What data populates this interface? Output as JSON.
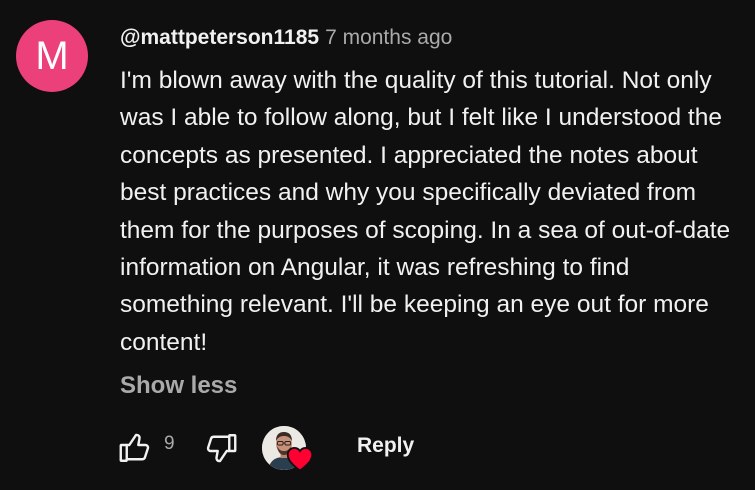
{
  "comment": {
    "avatar_letter": "M",
    "avatar_color": "#ec407a",
    "author": "@mattpeterson1185",
    "timestamp": "7 months ago",
    "text": "I'm blown away with the quality of this tutorial. Not only was I able to follow along, but I felt like I understood the concepts as presented. I appreciated the notes about best practices and why you specifically deviated from them for the purposes of scoping. In a sea of out-of-date information on Angular, it was refreshing to find something relevant. I'll be keeping an eye out for more content!",
    "show_less_label": "Show less"
  },
  "actions": {
    "like_icon": "thumbs-up-icon",
    "like_count": "9",
    "dislike_icon": "thumbs-down-icon",
    "creator_heart_icon": "heart-icon",
    "heart_color": "#ff0033",
    "reply_label": "Reply"
  },
  "theme": {
    "background": "#0f0f0f",
    "text_primary": "#f1f1f1",
    "text_secondary": "#aaaaaa"
  }
}
